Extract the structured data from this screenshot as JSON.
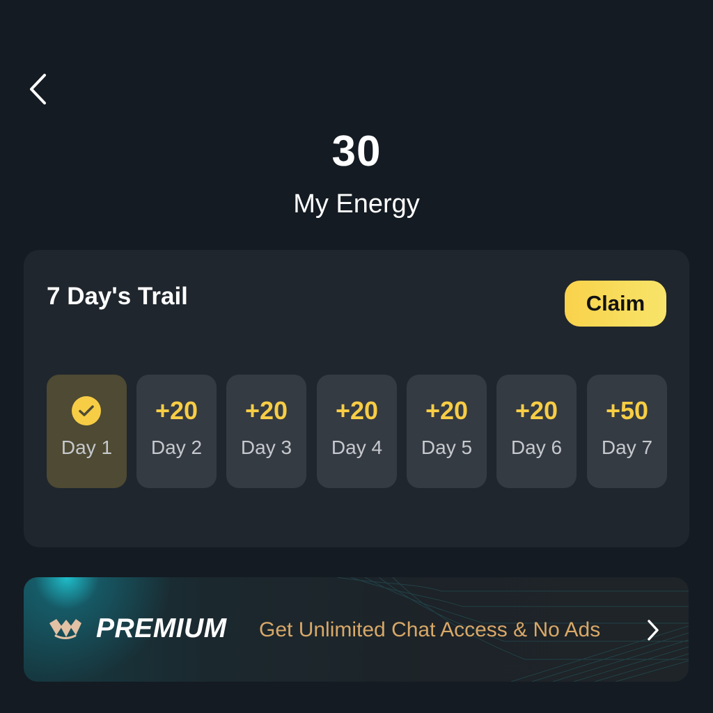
{
  "header": {
    "back_icon": "chevron-left-icon"
  },
  "energy": {
    "value": "30",
    "label": "My Energy"
  },
  "trial": {
    "title": "7 Day's Trail",
    "claim_label": "Claim",
    "days": [
      {
        "label": "Day 1",
        "reward": "",
        "claimed": true,
        "icon": "check-circle-icon"
      },
      {
        "label": "Day 2",
        "reward": "+20",
        "claimed": false
      },
      {
        "label": "Day 3",
        "reward": "+20",
        "claimed": false
      },
      {
        "label": "Day 4",
        "reward": "+20",
        "claimed": false
      },
      {
        "label": "Day 5",
        "reward": "+20",
        "claimed": false
      },
      {
        "label": "Day 6",
        "reward": "+20",
        "claimed": false
      },
      {
        "label": "Day 7",
        "reward": "+50",
        "claimed": false
      }
    ]
  },
  "premium": {
    "title": "PREMIUM",
    "description": "Get Unlimited Chat Access & No Ads",
    "logo_icon": "premium-logo-icon",
    "arrow_icon": "chevron-right-icon"
  },
  "colors": {
    "background": "#141b22",
    "card": "#20262d",
    "tile": "#353b43",
    "claimed_tile": "#4e4a33",
    "accent_yellow": "#f7cd45",
    "premium_text": "#d9a868",
    "premium_teal": "#20c5d2"
  }
}
